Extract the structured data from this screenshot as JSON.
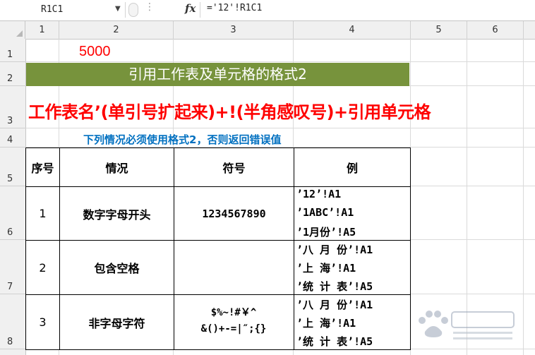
{
  "formula_bar": {
    "name_box": "R1C1",
    "fx_label": "fx",
    "formula": "='12'!R1C1"
  },
  "columns": [
    "1",
    "2",
    "3",
    "4",
    "5",
    "6"
  ],
  "rows": [
    "1",
    "2",
    "3",
    "4",
    "5",
    "6",
    "7",
    "8"
  ],
  "cells": {
    "value_r1": "5000",
    "title": "引用工作表及单元格的格式2",
    "format_line": "工作表名’(单引号扩起来)+!(半角感叹号)+引用单元格",
    "note": "下列情况必须使用格式2，否则返回错误值"
  },
  "table": {
    "headers": [
      "序号",
      "情况",
      "符号",
      "例"
    ],
    "rows": [
      {
        "no": "1",
        "situation": "数字字母开头",
        "symbol": [
          "1234567890"
        ],
        "examples": [
          "’12’!A1",
          "’1ABC’!A1",
          "’1月份’!A5"
        ]
      },
      {
        "no": "2",
        "situation": "包含空格",
        "symbol": [],
        "examples": [
          "’八 月 份’!A1",
          "’上 海’!A1",
          "’统 计 表’!A5"
        ]
      },
      {
        "no": "3",
        "situation": "非字母字符",
        "symbol": [
          "$%~!#￥^",
          "&()+-=|″;{}"
        ],
        "examples": [
          "’八 月 份’!A1",
          "’上 海’!A1",
          "’统 计 表’!A5"
        ]
      }
    ]
  },
  "colors": {
    "title_bg": "#77933c",
    "red_text": "#ff0000",
    "note_blue": "#0070c0"
  }
}
